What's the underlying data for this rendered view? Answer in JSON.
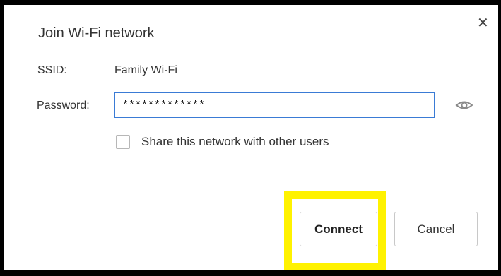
{
  "dialog": {
    "title": "Join Wi-Fi network",
    "close_icon": "close-icon"
  },
  "ssid": {
    "label": "SSID:",
    "value": "Family Wi-Fi"
  },
  "password": {
    "label": "Password:",
    "value": "*************",
    "reveal_icon": "eye-icon"
  },
  "share": {
    "label": "Share this network with other users",
    "checked": false
  },
  "buttons": {
    "connect_label": "Connect",
    "cancel_label": "Cancel"
  },
  "colors": {
    "highlight": "#fff200",
    "input_focus_border": "#3a7bd5"
  }
}
